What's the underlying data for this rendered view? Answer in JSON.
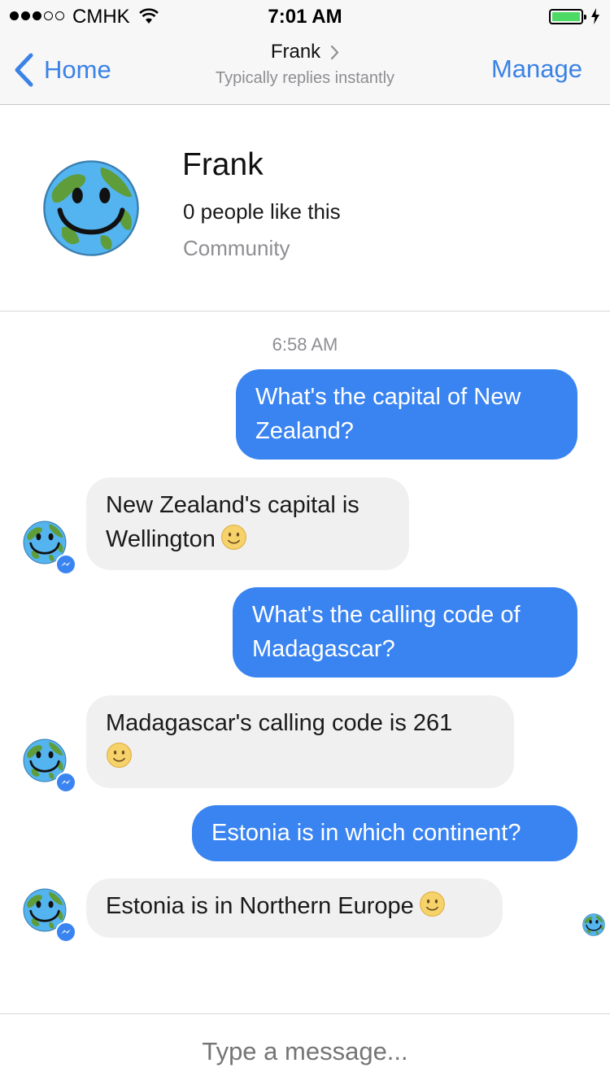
{
  "status_bar": {
    "carrier": "CMHK",
    "time": "7:01 AM",
    "signal_bars_filled": 3,
    "signal_bars_total": 5,
    "battery_level": 1.0,
    "battery_color": "#4cd964",
    "icons": [
      "wifi-icon",
      "battery-icon",
      "charging-bolt-icon"
    ]
  },
  "nav": {
    "back_label": "Home",
    "title": "Frank",
    "subtitle": "Typically replies instantly",
    "manage_label": "Manage",
    "accent_color": "#3b82e6"
  },
  "profile": {
    "name": "Frank",
    "likes": "0 people like this",
    "category": "Community",
    "avatar_icon": "smiling-globe-avatar"
  },
  "chat": {
    "timestamp": "6:58 AM",
    "outgoing_color": "#3a84f1",
    "incoming_color": "#f0f0f0",
    "messages": [
      {
        "from": "user",
        "line1": "What's the capital of New",
        "line2": "Zealand?"
      },
      {
        "from": "bot",
        "line1": "New Zealand's capital is",
        "line2": "Wellington",
        "emoji": "slightly-smiling-face"
      },
      {
        "from": "user",
        "line1": "What's the calling code of",
        "line2": "Madagascar?"
      },
      {
        "from": "bot",
        "line1": "Madagascar's calling code is 261",
        "emoji": "slightly-smiling-face"
      },
      {
        "from": "user",
        "line1": "Estonia is in which continent?"
      },
      {
        "from": "bot",
        "line1": "Estonia is in Northern Europe",
        "emoji": "slightly-smiling-face"
      }
    ]
  },
  "composer": {
    "placeholder": "Type a message..."
  }
}
